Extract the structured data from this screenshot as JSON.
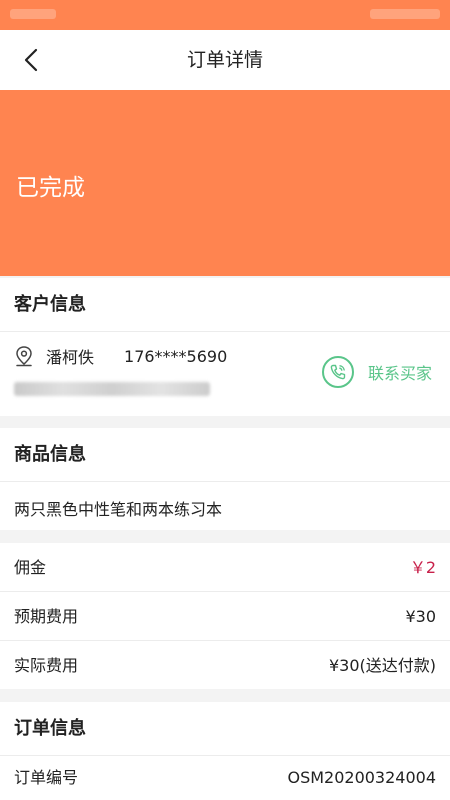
{
  "nav": {
    "title": "订单详情"
  },
  "banner": {
    "status": "已完成"
  },
  "customer": {
    "section_title": "客户信息",
    "name": "潘柯佚",
    "phone": "176****5690",
    "contact_label": "联系买家"
  },
  "goods": {
    "section_title": "商品信息",
    "description": "两只黑色中性笔和两本练习本"
  },
  "fees": {
    "commission_label": "佣金",
    "commission_value": "￥2",
    "expected_label": "预期费用",
    "expected_value": "¥30",
    "actual_label": "实际费用",
    "actual_value": "¥30(送达付款)"
  },
  "order": {
    "section_title": "订单信息",
    "number_label": "订单编号",
    "number_value": "OSM20200324004"
  },
  "colors": {
    "accent": "#ff8450",
    "contact": "#5ac58a",
    "commission": "#c8204a"
  },
  "icons": {
    "back": "chevron-left-icon",
    "location": "location-pin-icon",
    "phone": "phone-icon"
  }
}
